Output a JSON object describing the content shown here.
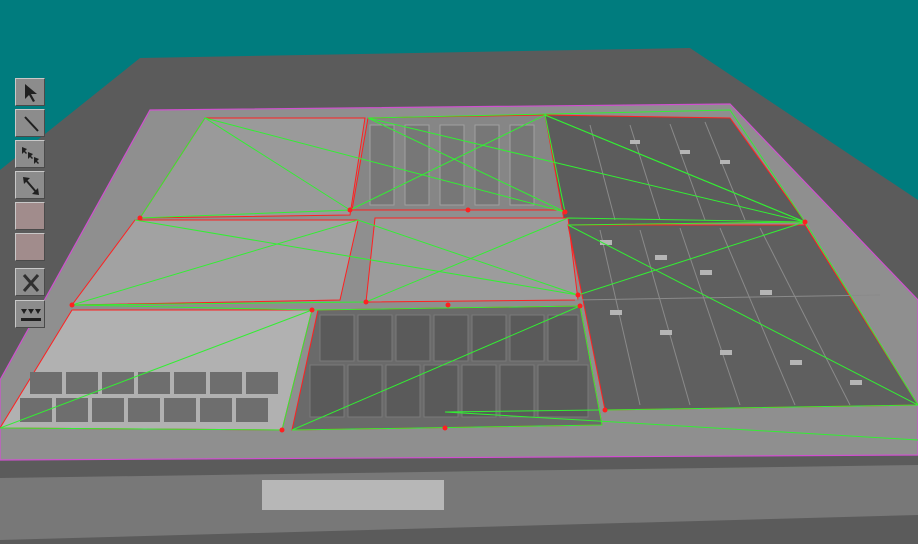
{
  "window": {
    "background_color": "#007c7e"
  },
  "scene": {
    "floor_color": "#5b5b5b",
    "slab_color": "#8f8f8f",
    "bottom_bar_color": "#787878",
    "bottom_highlight_color": "#b7b7b7",
    "boundary_color": "#d050d0",
    "wire_red_color": "#ff2020",
    "wire_green_color": "#33ee33"
  },
  "toolbar": {
    "tools": [
      {
        "name": "select-arrow-icon",
        "kind": "icon"
      },
      {
        "name": "line-tool-icon",
        "kind": "icon"
      },
      {
        "name": "multi-arrow-icon",
        "kind": "icon"
      },
      {
        "name": "double-arrow-icon",
        "kind": "icon"
      },
      {
        "name": "color-swatch-1",
        "kind": "swatch",
        "color": "#a18c8c"
      },
      {
        "name": "color-swatch-2",
        "kind": "swatch",
        "color": "#a18c8c"
      },
      {
        "name": "close-icon",
        "kind": "icon"
      },
      {
        "name": "level-icon",
        "kind": "icon"
      }
    ]
  }
}
